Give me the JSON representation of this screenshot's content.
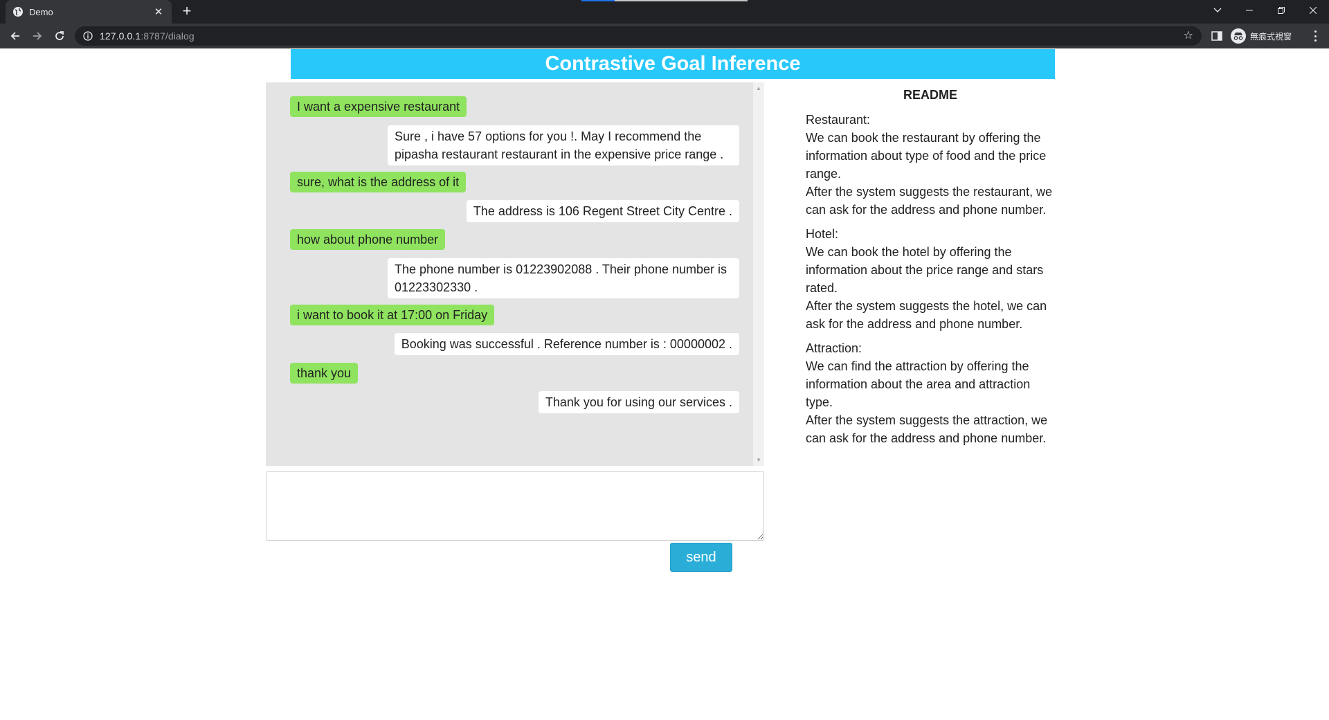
{
  "browser": {
    "tab_title": "Demo",
    "url_host": "127.0.0.1",
    "url_rest": ":8787/dialog",
    "profile_label": "無痕式視窗"
  },
  "page": {
    "banner_title": "Contrastive Goal Inference",
    "send_label": "send",
    "input_value": ""
  },
  "messages": [
    {
      "role": "user",
      "text": "I want a expensive restaurant"
    },
    {
      "role": "bot",
      "text": "Sure , i have 57 options for you !. May I recommend the pipasha restaurant restaurant in the expensive price range ."
    },
    {
      "role": "user",
      "text": "sure, what is the address of it"
    },
    {
      "role": "bot",
      "text": "The address is 106 Regent Street City Centre ."
    },
    {
      "role": "user",
      "text": "how about phone number"
    },
    {
      "role": "bot",
      "text": "The phone number is 01223902088 . Their phone number is 01223302330 ."
    },
    {
      "role": "user",
      "text": "i want to book it at 17:00 on Friday"
    },
    {
      "role": "bot",
      "text": "Booking was successful . Reference number is : 00000002 ."
    },
    {
      "role": "user",
      "text": "thank you"
    },
    {
      "role": "bot",
      "text": "Thank you for using our services ."
    }
  ],
  "readme": {
    "title": "README",
    "sections": [
      {
        "heading": "Restaurant:",
        "line1": "We can book the restaurant by offering the information about type of food and the price range.",
        "line2": "After the system suggests the restaurant, we can ask for the address and phone number."
      },
      {
        "heading": "Hotel:",
        "line1": "We can book the hotel by offering the information about the price range and stars rated.",
        "line2": "After the system suggests the hotel, we can ask for the address and phone number."
      },
      {
        "heading": "Attraction:",
        "line1": "We can find the attraction by offering the information about the area and attraction type.",
        "line2": "After the system suggests the attraction, we can ask for the address and phone number."
      }
    ]
  },
  "colors": {
    "banner": "#29c8fa",
    "user_bubble": "#8fe35f",
    "bot_bubble": "#ffffff",
    "chat_background": "#e4e4e4",
    "send_button": "#2aaed8"
  }
}
